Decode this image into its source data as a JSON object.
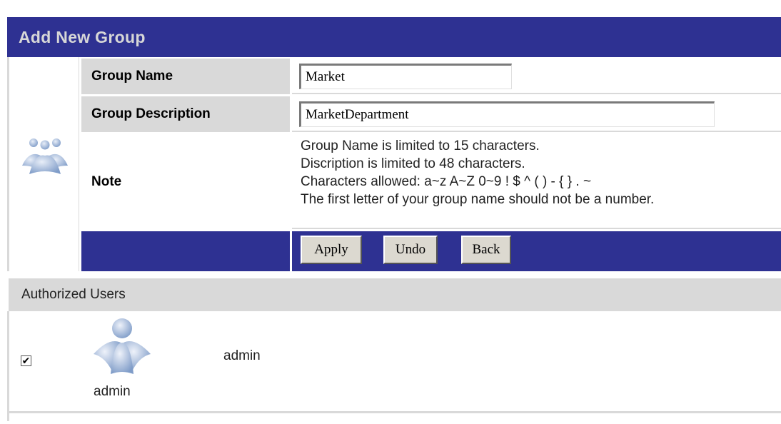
{
  "form": {
    "title": "Add New Group",
    "group_name_label": "Group Name",
    "group_name_value": "Market",
    "group_description_label": "Group Description",
    "group_description_value": "MarketDepartment",
    "note_label": "Note",
    "note_lines": [
      "Group Name is limited to 15 characters.",
      "Discription is limited to 48   characters.",
      "Characters allowed: a~z A~Z 0~9 ! $ ^ ( ) - { } . ~",
      "The first letter of your group name should not be a number."
    ],
    "buttons": {
      "apply": "Apply",
      "undo": "Undo",
      "back": "Back"
    },
    "group_icon": "group-icon"
  },
  "authorized_users": {
    "header": "Authorized Users",
    "users": [
      {
        "checked": true,
        "icon": "user-icon",
        "caption": "admin",
        "name": "admin"
      }
    ]
  },
  "colors": {
    "primary": "#2e3192",
    "header_text": "#d7d7d7",
    "label_bg": "#d9d9d9"
  }
}
